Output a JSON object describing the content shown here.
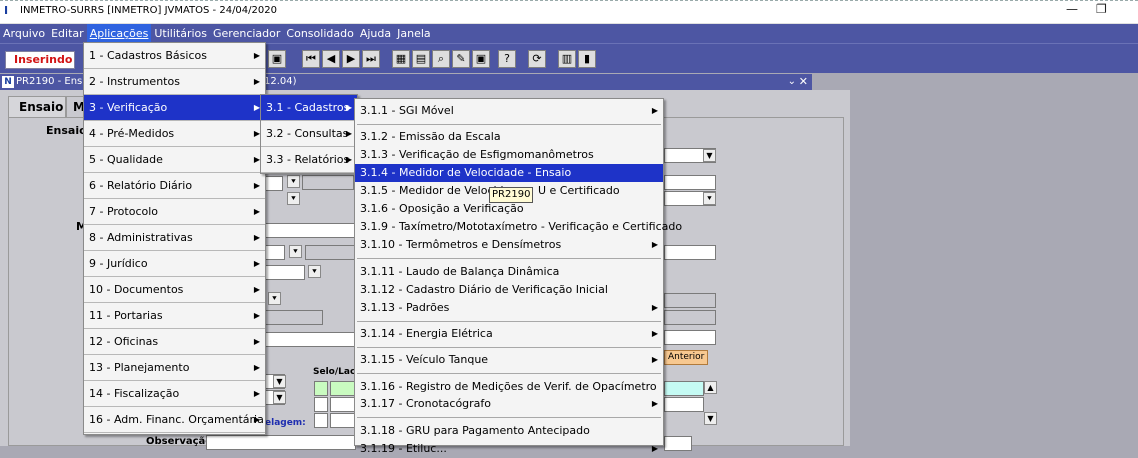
{
  "window": {
    "title": "INMETRO-SURRS  [INMETRO]   JVMATOS - 24/04/2020",
    "minimize": "—",
    "restore": "❐"
  },
  "menubar": [
    "Arquivo",
    "Editar",
    "Aplicações",
    "Utilitários",
    "Gerenciador",
    "Consolidado",
    "Ajuda",
    "Janela"
  ],
  "toolbar": {
    "status": "Inserindo",
    "buttons": [
      "⏮",
      "◀",
      "▶",
      "⏭",
      "▦",
      "▤",
      "⌕",
      "✎",
      "▣",
      "?",
      "⟳",
      "▥",
      "▮"
    ]
  },
  "form": {
    "title_prefix": "PR2190 - Ens",
    "title_suffix": "12.04)",
    "tab_ensaio": "Ensaio",
    "tab_m": "M",
    "label_ensaio": "Ensaio",
    "label_m": "M",
    "label_selo": "Selo/Lac",
    "label_elagem": "elagem:",
    "label_observacao": "Observação",
    "btn_anterior": "Anterior"
  },
  "menu_aplicacoes": {
    "items": [
      "1 - Cadastros Básicos",
      "2 - Instrumentos",
      "3 - Verificação",
      "4 - Pré-Medidos",
      "5 - Qualidade",
      "6 - Relatório Diário",
      "7 - Protocolo",
      "8 - Administrativas",
      "9 - Jurídico",
      "10 - Documentos",
      "11 - Portarias",
      "12 - Oficinas",
      "13 - Planejamento",
      "14 - Fiscalização",
      "16 - Adm. Financ. Orçamentária"
    ],
    "highlighted": "3 - Verificação"
  },
  "menu_verificacao": {
    "items": [
      "3.1 - Cadastros",
      "3.2 - Consultas",
      "3.3 - Relatórios"
    ],
    "highlighted": "3.1 - Cadastros"
  },
  "menu_cadastros": {
    "items": [
      "3.1.1 - SGI Móvel",
      "3.1.2 - Emissão da Escala",
      "3.1.3 - Verificação de Esfigmomanômetros",
      "3.1.4 - Medidor de Velocidade - Ensaio",
      "3.1.5 - Medidor de Velocid",
      "3.1.6 - Oposição a Verificação",
      "3.1.9 - Taxímetro/Mototaxímetro - Verificação e Certificado",
      "3.1.10 - Termômetros e Densímetros",
      "3.1.11 - Laudo de Balança Dinâmica",
      "3.1.12 - Cadastro Diário de Verificação Inicial",
      "3.1.13 - Padrões",
      "3.1.14 - Energia Elétrica",
      "3.1.15 - Veículo Tanque",
      "3.1.16 - Registro de Medições de Verif. de Opacímetro",
      "3.1.17 - Cronotacógrafo",
      "3.1.18 - GRU para Pagamento Antecipado",
      "3.1.19 - Etiluc..."
    ],
    "item5_suffix": "U e Certificado",
    "highlighted": "3.1.4 - Medidor de Velocidade - Ensaio"
  },
  "tooltip": "PR2190"
}
